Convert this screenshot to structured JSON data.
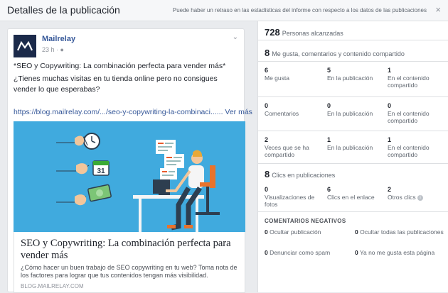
{
  "header": {
    "title": "Detalles de la publicación",
    "notice": "Puede haber un retraso en las estadísticas del informe con respecto a los datos de las publicaciones",
    "close": "×"
  },
  "post": {
    "page_name": "Mailrelay",
    "time": "23 h ·",
    "text_1": "*SEO y Copywriting: La combinación perfecta para vender más*",
    "text_2": "¿Tienes muchas visitas en tu tienda online pero no consigues vender lo que esperabas?",
    "url": "https://blog.mailrelay.com/.../seo-y-copywriting-la-combinaci......",
    "see_more": "Ver más",
    "calendar_day": "31",
    "link_title": "SEO y Copywriting: La combinación perfecta para vender más",
    "link_desc": "¿Cómo hacer un buen trabajo de SEO copywriting en tu web? Toma nota de los factores para lograr que tus contenidos tengan más visibilidad.",
    "link_domain": "BLOG.MAILRELAY.COM"
  },
  "stats": {
    "reach": {
      "num": "728",
      "label": "Personas alcanzadas"
    },
    "engagement": {
      "num": "8",
      "label": "Me gusta, comentarios y contenido compartido"
    },
    "likes": [
      {
        "num": "6",
        "label": "Me gusta"
      },
      {
        "num": "5",
        "label": "En la publicación"
      },
      {
        "num": "1",
        "label": "En el contenido compartido"
      }
    ],
    "comments": [
      {
        "num": "0",
        "label": "Comentarios"
      },
      {
        "num": "0",
        "label": "En la publicación"
      },
      {
        "num": "0",
        "label": "En el contenido compartido"
      }
    ],
    "shares": [
      {
        "num": "2",
        "label": "Veces que se ha compartido"
      },
      {
        "num": "1",
        "label": "En la publicación"
      },
      {
        "num": "1",
        "label": "En el contenido compartido"
      }
    ],
    "clicks": {
      "num": "8",
      "label": "Clics en publicaciones"
    },
    "click_items": [
      {
        "num": "0",
        "label": "Visualizaciones de fotos"
      },
      {
        "num": "6",
        "label": "Clics en el enlace"
      },
      {
        "num": "2",
        "label": "Otros clics"
      }
    ],
    "negative_title": "COMENTARIOS NEGATIVOS",
    "negative": [
      {
        "num": "0",
        "label": "Ocultar publicación"
      },
      {
        "num": "0",
        "label": "Ocultar todas las publicaciones"
      },
      {
        "num": "0",
        "label": "Denunciar como spam"
      },
      {
        "num": "0",
        "label": "Ya no me gusta esta página"
      }
    ]
  }
}
